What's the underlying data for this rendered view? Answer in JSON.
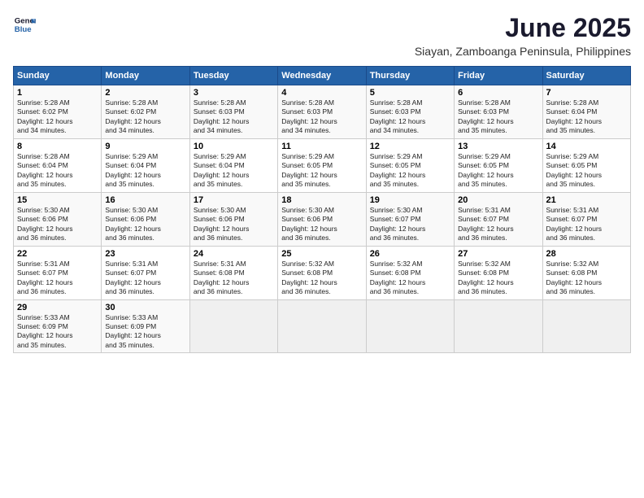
{
  "logo": {
    "line1": "General",
    "line2": "Blue"
  },
  "title": "June 2025",
  "subtitle": "Siayan, Zamboanga Peninsula, Philippines",
  "weekdays": [
    "Sunday",
    "Monday",
    "Tuesday",
    "Wednesday",
    "Thursday",
    "Friday",
    "Saturday"
  ],
  "weeks": [
    [
      {
        "day": "1",
        "info": "Sunrise: 5:28 AM\nSunset: 6:02 PM\nDaylight: 12 hours\nand 34 minutes."
      },
      {
        "day": "2",
        "info": "Sunrise: 5:28 AM\nSunset: 6:02 PM\nDaylight: 12 hours\nand 34 minutes."
      },
      {
        "day": "3",
        "info": "Sunrise: 5:28 AM\nSunset: 6:03 PM\nDaylight: 12 hours\nand 34 minutes."
      },
      {
        "day": "4",
        "info": "Sunrise: 5:28 AM\nSunset: 6:03 PM\nDaylight: 12 hours\nand 34 minutes."
      },
      {
        "day": "5",
        "info": "Sunrise: 5:28 AM\nSunset: 6:03 PM\nDaylight: 12 hours\nand 34 minutes."
      },
      {
        "day": "6",
        "info": "Sunrise: 5:28 AM\nSunset: 6:03 PM\nDaylight: 12 hours\nand 35 minutes."
      },
      {
        "day": "7",
        "info": "Sunrise: 5:28 AM\nSunset: 6:04 PM\nDaylight: 12 hours\nand 35 minutes."
      }
    ],
    [
      {
        "day": "8",
        "info": "Sunrise: 5:28 AM\nSunset: 6:04 PM\nDaylight: 12 hours\nand 35 minutes."
      },
      {
        "day": "9",
        "info": "Sunrise: 5:29 AM\nSunset: 6:04 PM\nDaylight: 12 hours\nand 35 minutes."
      },
      {
        "day": "10",
        "info": "Sunrise: 5:29 AM\nSunset: 6:04 PM\nDaylight: 12 hours\nand 35 minutes."
      },
      {
        "day": "11",
        "info": "Sunrise: 5:29 AM\nSunset: 6:05 PM\nDaylight: 12 hours\nand 35 minutes."
      },
      {
        "day": "12",
        "info": "Sunrise: 5:29 AM\nSunset: 6:05 PM\nDaylight: 12 hours\nand 35 minutes."
      },
      {
        "day": "13",
        "info": "Sunrise: 5:29 AM\nSunset: 6:05 PM\nDaylight: 12 hours\nand 35 minutes."
      },
      {
        "day": "14",
        "info": "Sunrise: 5:29 AM\nSunset: 6:05 PM\nDaylight: 12 hours\nand 35 minutes."
      }
    ],
    [
      {
        "day": "15",
        "info": "Sunrise: 5:30 AM\nSunset: 6:06 PM\nDaylight: 12 hours\nand 36 minutes."
      },
      {
        "day": "16",
        "info": "Sunrise: 5:30 AM\nSunset: 6:06 PM\nDaylight: 12 hours\nand 36 minutes."
      },
      {
        "day": "17",
        "info": "Sunrise: 5:30 AM\nSunset: 6:06 PM\nDaylight: 12 hours\nand 36 minutes."
      },
      {
        "day": "18",
        "info": "Sunrise: 5:30 AM\nSunset: 6:06 PM\nDaylight: 12 hours\nand 36 minutes."
      },
      {
        "day": "19",
        "info": "Sunrise: 5:30 AM\nSunset: 6:07 PM\nDaylight: 12 hours\nand 36 minutes."
      },
      {
        "day": "20",
        "info": "Sunrise: 5:31 AM\nSunset: 6:07 PM\nDaylight: 12 hours\nand 36 minutes."
      },
      {
        "day": "21",
        "info": "Sunrise: 5:31 AM\nSunset: 6:07 PM\nDaylight: 12 hours\nand 36 minutes."
      }
    ],
    [
      {
        "day": "22",
        "info": "Sunrise: 5:31 AM\nSunset: 6:07 PM\nDaylight: 12 hours\nand 36 minutes."
      },
      {
        "day": "23",
        "info": "Sunrise: 5:31 AM\nSunset: 6:07 PM\nDaylight: 12 hours\nand 36 minutes."
      },
      {
        "day": "24",
        "info": "Sunrise: 5:31 AM\nSunset: 6:08 PM\nDaylight: 12 hours\nand 36 minutes."
      },
      {
        "day": "25",
        "info": "Sunrise: 5:32 AM\nSunset: 6:08 PM\nDaylight: 12 hours\nand 36 minutes."
      },
      {
        "day": "26",
        "info": "Sunrise: 5:32 AM\nSunset: 6:08 PM\nDaylight: 12 hours\nand 36 minutes."
      },
      {
        "day": "27",
        "info": "Sunrise: 5:32 AM\nSunset: 6:08 PM\nDaylight: 12 hours\nand 36 minutes."
      },
      {
        "day": "28",
        "info": "Sunrise: 5:32 AM\nSunset: 6:08 PM\nDaylight: 12 hours\nand 36 minutes."
      }
    ],
    [
      {
        "day": "29",
        "info": "Sunrise: 5:33 AM\nSunset: 6:09 PM\nDaylight: 12 hours\nand 35 minutes."
      },
      {
        "day": "30",
        "info": "Sunrise: 5:33 AM\nSunset: 6:09 PM\nDaylight: 12 hours\nand 35 minutes."
      },
      {
        "day": "",
        "info": ""
      },
      {
        "day": "",
        "info": ""
      },
      {
        "day": "",
        "info": ""
      },
      {
        "day": "",
        "info": ""
      },
      {
        "day": "",
        "info": ""
      }
    ]
  ]
}
